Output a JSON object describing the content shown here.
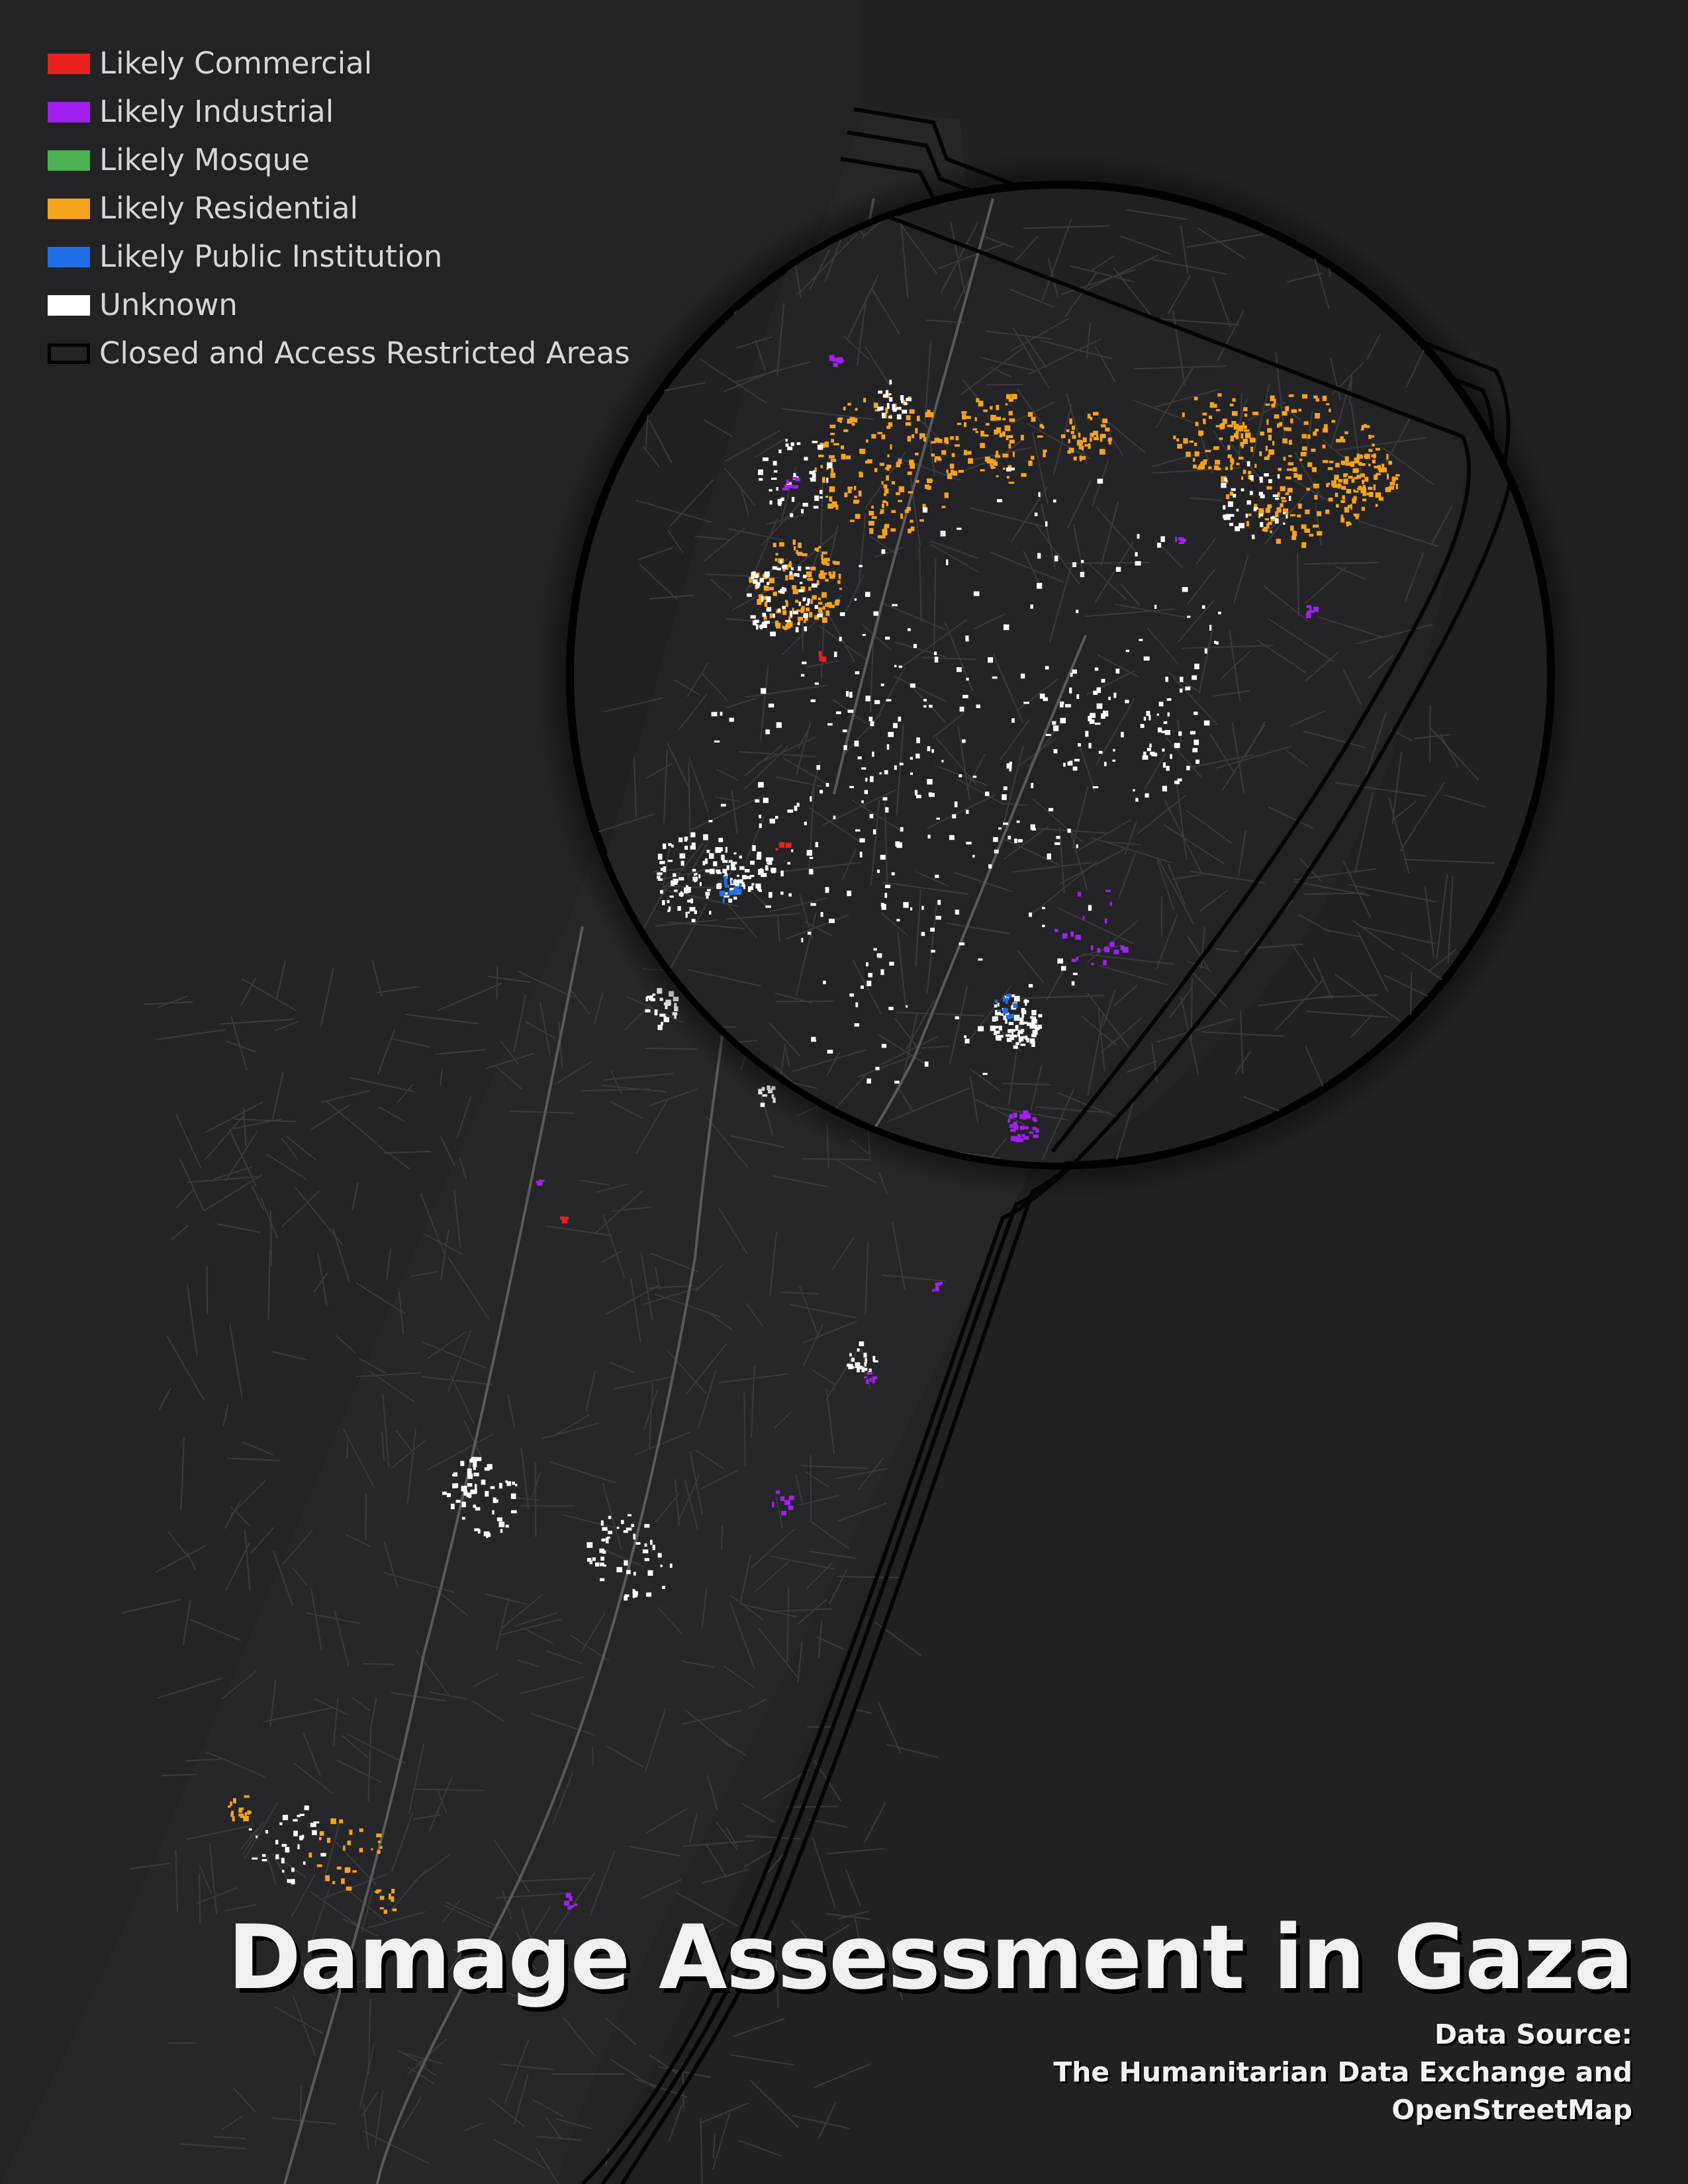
{
  "legend": {
    "items": [
      {
        "label": "Likely Commercial",
        "color": "#e8211f",
        "style": "fill"
      },
      {
        "label": "Likely Industrial",
        "color": "#a21ff0",
        "style": "fill"
      },
      {
        "label": "Likely Mosque",
        "color": "#4caf50",
        "style": "fill"
      },
      {
        "label": "Likely Residential",
        "color": "#f5a31a",
        "style": "fill"
      },
      {
        "label": "Likely Public Institution",
        "color": "#1e6fe6",
        "style": "fill"
      },
      {
        "label": "Unknown",
        "color": "#ffffff",
        "style": "fill"
      },
      {
        "label": "Closed and Access Restricted Areas",
        "color": "#000000",
        "style": "outline"
      }
    ]
  },
  "title": "Damage Assessment in Gaza",
  "source": {
    "heading": "Data Source:",
    "line1": "The Humanitarian Data Exchange and",
    "line2": "OpenStreetMap"
  },
  "colors": {
    "background": "#232325",
    "land": "#1f1f21",
    "road": "#3d3d40",
    "boundary": "#000000",
    "loupe_fill": "#202022"
  }
}
